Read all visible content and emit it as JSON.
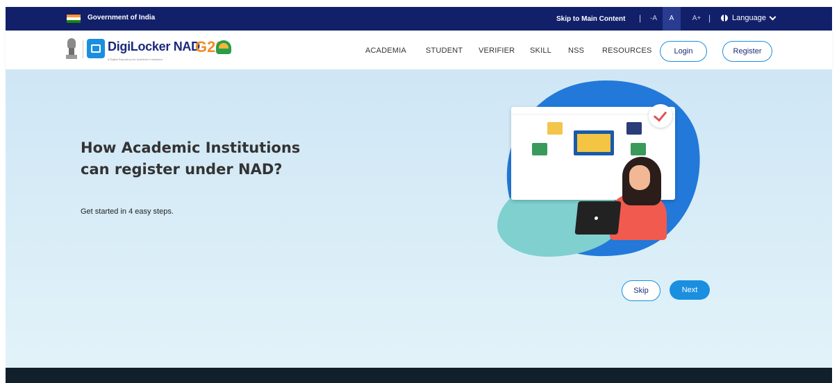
{
  "gov_bar": {
    "label": "Government of India",
    "skip_link": "Skip to Main Content",
    "font_decrease": "-A",
    "font_normal": "A",
    "font_increase": "A+",
    "language_label": "Language"
  },
  "header": {
    "brand": "DigiLocker NAD",
    "g20": "G20",
    "tagline": "A Digital Repository for Academic Institutions",
    "nav_items": [
      "ACADEMIA",
      "STUDENT",
      "VERIFIER",
      "SKILL",
      "NSS",
      "RESOURCES"
    ],
    "login": "Login",
    "register": "Register"
  },
  "hero": {
    "title": "How Academic Institutions can register under NAD?",
    "subtitle": "Get started in 4 easy steps.",
    "skip": "Skip",
    "next": "Next"
  },
  "colors": {
    "navy": "#12206a",
    "accent_blue": "#1a8fe0",
    "hero_bg": "#d4eaf6",
    "footer": "#12202c"
  }
}
